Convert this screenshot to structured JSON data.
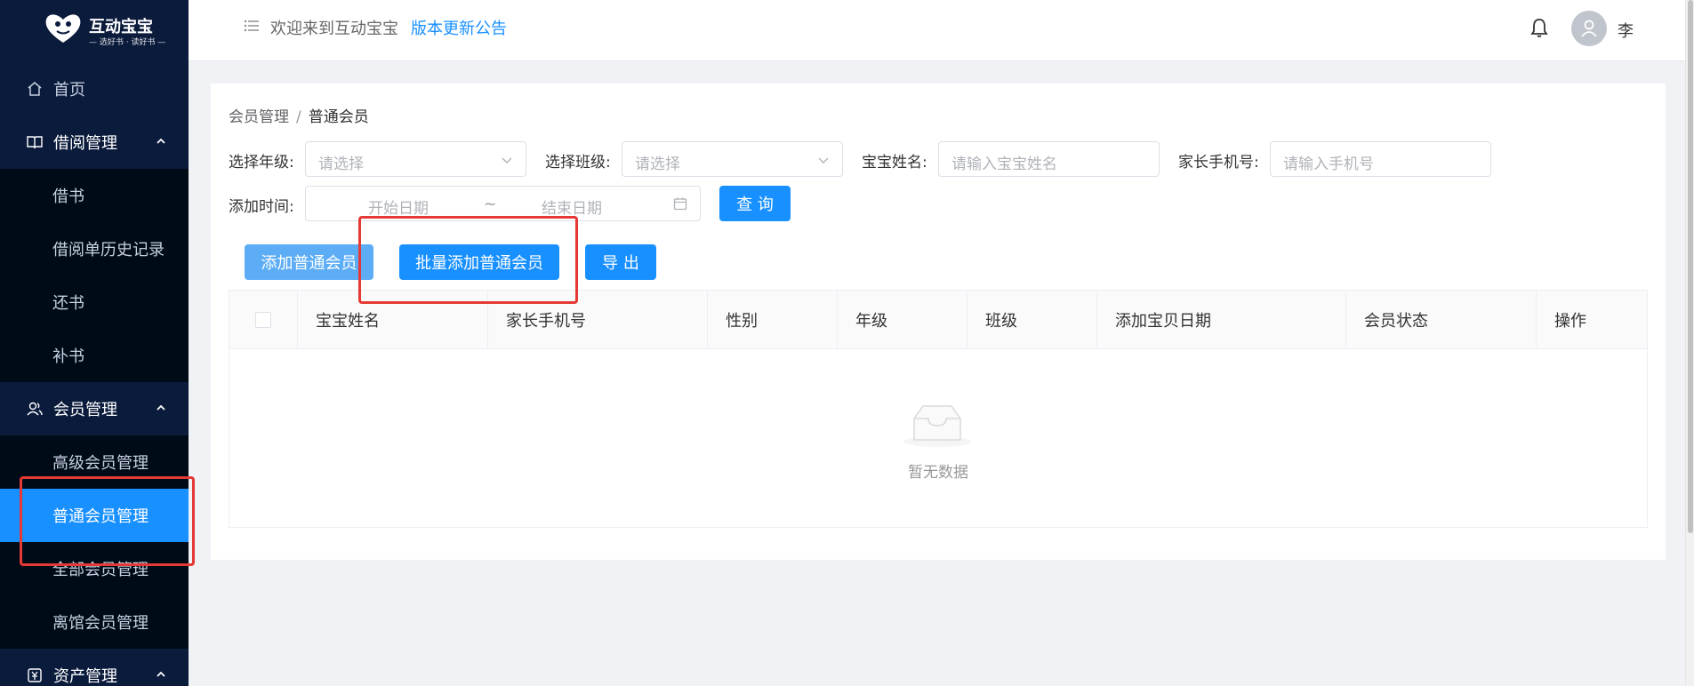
{
  "app": {
    "logo_title": "互动宝宝",
    "logo_tagline": "— 选好书 · 读好书 —"
  },
  "sidebar": {
    "home": "首页",
    "groups": [
      {
        "label": "借阅管理",
        "icon": "book-icon",
        "items": [
          "借书",
          "借阅单历史记录",
          "还书",
          "补书"
        ]
      },
      {
        "label": "会员管理",
        "icon": "members-icon",
        "items": [
          "高级会员管理",
          "普通会员管理",
          "全部会员管理",
          "离馆会员管理"
        ]
      },
      {
        "label": "资产管理",
        "icon": "assets-icon",
        "items": []
      }
    ],
    "active_item": "普通会员管理"
  },
  "header": {
    "welcome": "欢迎来到互动宝宝",
    "notice_link": "版本更新公告",
    "username": "李"
  },
  "breadcrumb": {
    "parent": "会员管理",
    "separator": "/",
    "current": "普通会员"
  },
  "filters": {
    "grade_label": "选择年级:",
    "grade_placeholder": "请选择",
    "class_label": "选择班级:",
    "class_placeholder": "请选择",
    "baby_name_label": "宝宝姓名:",
    "baby_name_placeholder": "请输入宝宝姓名",
    "phone_label": "家长手机号:",
    "phone_placeholder": "请输入手机号",
    "date_label": "添加时间:",
    "start_placeholder": "开始日期",
    "range_sep": "~",
    "end_placeholder": "结束日期",
    "query_button": "查 询"
  },
  "actions": {
    "add_member": "添加普通会员",
    "bulk_add_member": "批量添加普通会员",
    "export": "导 出"
  },
  "table": {
    "columns": [
      "宝宝姓名",
      "家长手机号",
      "性别",
      "年级",
      "班级",
      "添加宝贝日期",
      "会员状态",
      "操作"
    ],
    "rows": [],
    "empty_text": "暂无数据"
  },
  "colors": {
    "sidebar_bg": "#0b1b3c",
    "submenu_bg": "#000b18",
    "primary": "#1890ff",
    "annotation_red": "#e53935"
  }
}
